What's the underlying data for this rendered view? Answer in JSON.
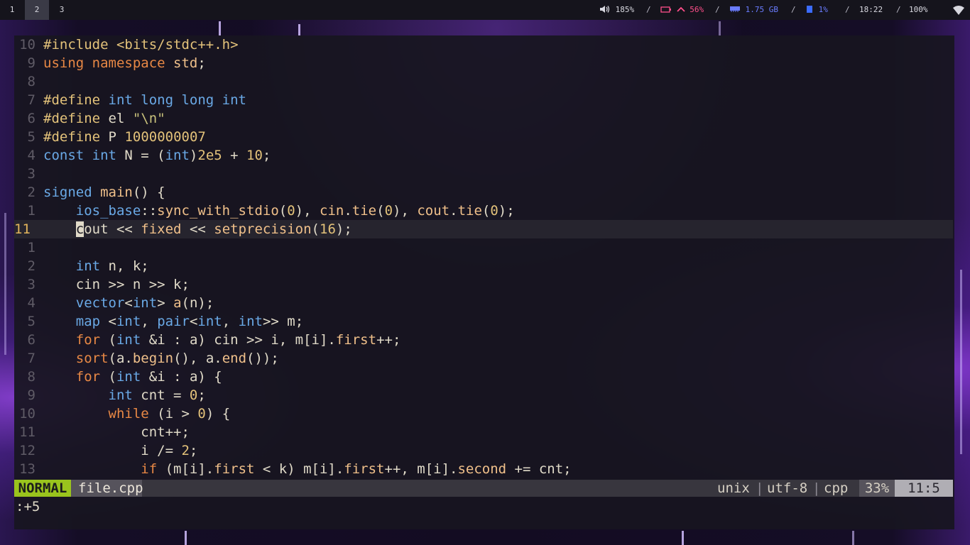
{
  "topbar": {
    "workspaces": [
      {
        "label": "1",
        "active": false
      },
      {
        "label": "2",
        "active": true
      },
      {
        "label": "3",
        "active": false
      }
    ],
    "volume": "185%",
    "battery": "56%",
    "memory": "1.75 GB",
    "cpu": "1%",
    "clock": "18:22",
    "brightness": "100%",
    "separator": "/"
  },
  "editor": {
    "lines": [
      {
        "num": "10",
        "html": "<span class='pp'>#include &lt;bits/stdc++.h&gt;</span>"
      },
      {
        "num": "9",
        "html": "<span class='kw'>using namespace</span> <span class='fn'>std</span>;"
      },
      {
        "num": "8",
        "html": ""
      },
      {
        "num": "7",
        "html": "<span class='pp'>#define</span> <span class='ty'>int long long int</span>"
      },
      {
        "num": "6",
        "html": "<span class='pp'>#define</span> <span class='pl'>el</span> <span class='st'>\"\\n\"</span>"
      },
      {
        "num": "5",
        "html": "<span class='pp'>#define</span> <span class='pl'>P</span> <span class='nm'>1000000007</span>"
      },
      {
        "num": "4",
        "html": "<span class='ty'>const int</span> N = (<span class='ty'>int</span>)<span class='nm'>2e5</span> + <span class='nm'>10</span>;"
      },
      {
        "num": "3",
        "html": ""
      },
      {
        "num": "2",
        "html": "<span class='ty'>signed</span> <span class='fn'>main</span>() {"
      },
      {
        "num": "1",
        "html": "    <span class='ty'>ios_base</span>::<span class='fn'>sync_with_stdio</span>(<span class='nm'>0</span>), <span class='fn'>cin</span>.<span class='fn'>tie</span>(<span class='nm'>0</span>), <span class='fn'>cout</span>.<span class='fn'>tie</span>(<span class='nm'>0</span>);"
      },
      {
        "num": "11",
        "current": true,
        "html": "    <span class='cursor'>c</span>out &lt;&lt; <span class='fn'>fixed</span> &lt;&lt; <span class='fn'>setprecision</span>(<span class='nm'>16</span>);"
      },
      {
        "num": "1",
        "html": ""
      },
      {
        "num": "2",
        "html": "    <span class='ty'>int</span> n, k;"
      },
      {
        "num": "3",
        "html": "    cin &gt;&gt; n &gt;&gt; k;"
      },
      {
        "num": "4",
        "html": "    <span class='ty'>vector</span>&lt;<span class='ty'>int</span>&gt; <span class='fn'>a</span>(n);"
      },
      {
        "num": "5",
        "html": "    <span class='ty'>map</span> &lt;<span class='ty'>int</span>, <span class='ty'>pair</span>&lt;<span class='ty'>int</span>, <span class='ty'>int</span>&gt;&gt; m;"
      },
      {
        "num": "6",
        "html": "    <span class='kw'>for</span> (<span class='ty'>int</span> &amp;i : a) cin &gt;&gt; i, m[i].<span class='fn'>first</span>++;"
      },
      {
        "num": "7",
        "html": "    <span class='kw'>sort</span>(a.<span class='fn'>begin</span>(), a.<span class='fn'>end</span>());"
      },
      {
        "num": "8",
        "html": "    <span class='kw'>for</span> (<span class='ty'>int</span> &amp;i : a) {"
      },
      {
        "num": "9",
        "html": "        <span class='ty'>int</span> cnt = <span class='nm'>0</span>;"
      },
      {
        "num": "10",
        "html": "        <span class='kw'>while</span> (i &gt; <span class='nm'>0</span>) {"
      },
      {
        "num": "11",
        "html": "            cnt++;"
      },
      {
        "num": "12",
        "html": "            i /= <span class='nm'>2</span>;"
      },
      {
        "num": "13",
        "html": "            <span class='kw'>if</span> (m[i].<span class='fn'>first</span> &lt; k) m[i].<span class='fn'>first</span>++, m[i].<span class='fn'>second</span> += cnt;"
      }
    ]
  },
  "statusline": {
    "mode": "NORMAL",
    "file": "file.cpp",
    "fileformat": "unix",
    "encoding": "utf-8",
    "filetype": "cpp",
    "percent": "33%",
    "position": "11:5",
    "divider": "|"
  },
  "cmdline": ":+5",
  "colors": {
    "mode_bg": "#9ac41d",
    "battery_accent": "#ff4f8b",
    "memory_accent": "#6a7cff"
  }
}
